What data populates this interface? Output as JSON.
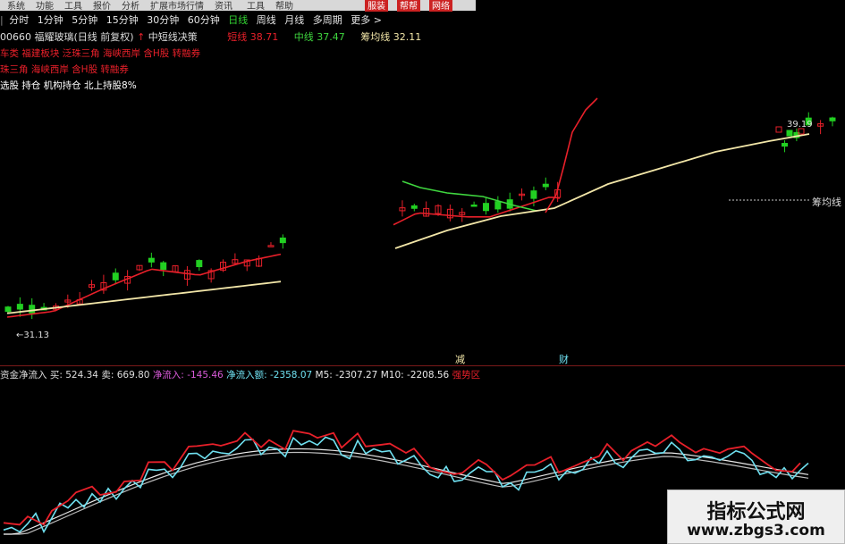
{
  "topbar": {
    "items": [
      "系统",
      "功能",
      "工具",
      "报价",
      "分析",
      "扩展市场行情",
      "资讯",
      "工具",
      "帮助"
    ],
    "highlight": [
      "服装",
      "帮帮",
      "网络"
    ]
  },
  "tabs": [
    "|",
    "分时",
    "1分钟",
    "5分钟",
    "15分钟",
    "30分钟",
    "60分钟",
    "日线",
    "周线",
    "月线",
    "多周期",
    "更多 >"
  ],
  "active_tab": "日线",
  "stock_info": {
    "code": "00660 福耀玻璃(日线 前复权)",
    "arrow": "↑",
    "label": "中短线决策",
    "k1_label": "短线",
    "k1_value": "38.71",
    "k2_label": "中线",
    "k2_value": "37.47",
    "k3_label": "筹均线",
    "k3_value": "32.11"
  },
  "concepts": [
    "车类 福建板块 泛珠三角 海峡西岸 含H股 转融券",
    "珠三角 海峡西岸 含H股 转融券"
  ],
  "tags": "选股 持仓 机构持仓 北上持股8%",
  "annotations": {
    "left_price": "←31.13",
    "mark1": "减",
    "mark2": "财",
    "ma_label": "筹均线",
    "right_price": "39.19"
  },
  "indicator_header": {
    "title": "资金净流入",
    "buy_label": "买:",
    "buy_value": "524.34",
    "sell_label": "卖:",
    "sell_value": "669.80",
    "net_label": "净流入:",
    "net_value": "-145.46",
    "total_label": "净流入额:",
    "total_value": "-2358.07",
    "m5_label": "M5:",
    "m5_value": "-2307.27",
    "m10_label": "M10:",
    "m10_value": "-2208.56",
    "status": "强势区"
  },
  "watermark": {
    "line1": "指标公式网",
    "line2": "www.zbgs3.com"
  },
  "colors": {
    "up": "#e8202a",
    "down": "#22d022",
    "ma_short": "#e8202a",
    "ma_mid": "#3fd63f",
    "ma_long": "#f2e6a8",
    "net_flow": "#6fe0f0",
    "m5": "#e8e8e8",
    "m10": "#e8202a",
    "tab_active": "#32d532"
  },
  "chart_data": [
    {
      "type": "candlestick",
      "title": "福耀玻璃 日线",
      "series": [
        {
          "name": "短线",
          "values": [
            38.71
          ]
        },
        {
          "name": "中线",
          "values": [
            37.47
          ]
        },
        {
          "name": "筹均线",
          "values": [
            32.11
          ]
        }
      ],
      "annotations": [
        "←31.13",
        "减",
        "财",
        "筹均线"
      ]
    },
    {
      "type": "line",
      "title": "资金净流入",
      "series": [
        {
          "name": "净流入额",
          "values": [
            -2358.07
          ]
        },
        {
          "name": "M5",
          "values": [
            -2307.27
          ]
        },
        {
          "name": "M10",
          "values": [
            -2208.56
          ]
        }
      ]
    }
  ]
}
